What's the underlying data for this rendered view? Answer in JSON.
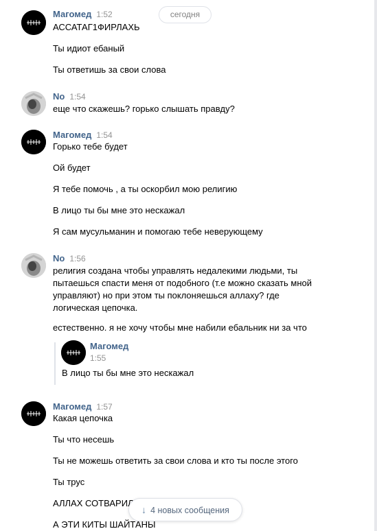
{
  "date_divider": "сегодня",
  "groups": [
    {
      "sender": "Магомед",
      "time": "1:52",
      "avatar": "black-logo",
      "messages": [
        "АССАТАГ1ФИРЛАХЬ",
        "Ты идиот ебаный",
        "Ты ответишь за свои слова"
      ]
    },
    {
      "sender": "No",
      "time": "1:54",
      "avatar": "gray-photo",
      "messages": [
        "еще что скажешь? горько слышать правду?"
      ]
    },
    {
      "sender": "Магомед",
      "time": "1:54",
      "avatar": "black-logo",
      "messages": [
        "Горько тебе будет",
        "Ой будет",
        "Я тебе помочь , а ты оскорбил мою религию",
        "В лицо ты бы мне это нескажал",
        "Я сам мусульманин и помогаю тебе неверующему"
      ]
    },
    {
      "sender": "No",
      "time": "1:56",
      "avatar": "gray-photo",
      "messages": [
        "религия создана чтобы управлять недалекими людьми, ты пытаешься спасти меня от подобного (т.е можно сказать мной управляют) но при этом ты поклоняешься аллаху? где логическая цепочка.",
        "естественно. я не хочу чтобы мне набили ебальник ни за что"
      ],
      "reply": {
        "sender": "Магомед",
        "time": "1:55",
        "text": "В лицо ты бы мне это нескажал"
      }
    },
    {
      "sender": "Магомед",
      "time": "1:57",
      "avatar": "black-logo",
      "messages": [
        "Какая цепочка",
        "Ты что несешь",
        "Ты не можешь ответить за свои слова и кто ты после этого",
        "Ты трус",
        "АЛЛАХ СОТВАРИЛ",
        "А ЭТИ КИТЫ ШАЙТАНЫ"
      ]
    }
  ],
  "new_messages_label": "4 новых сообщения",
  "colors": {
    "name": "#42648b",
    "time": "#939393",
    "border": "#dfe2e8"
  }
}
